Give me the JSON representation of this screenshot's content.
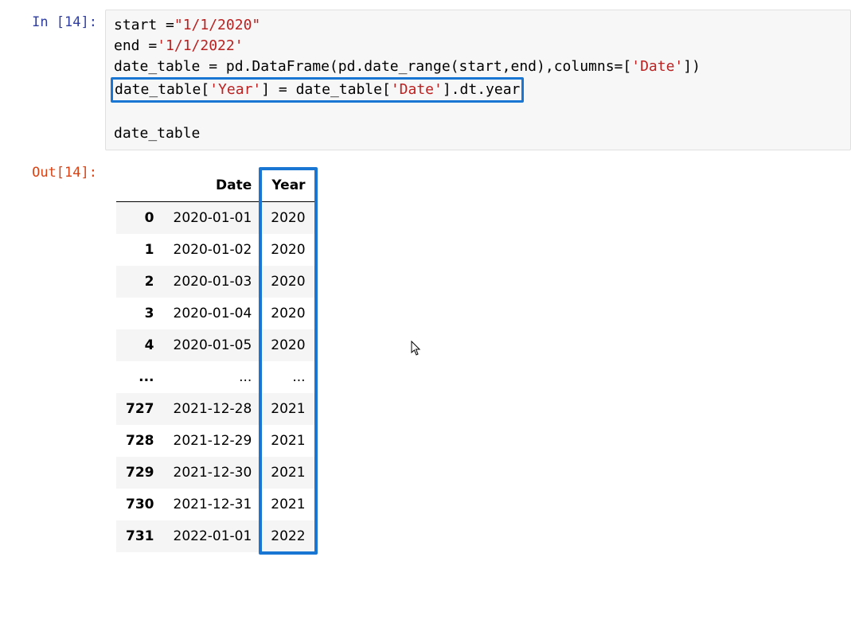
{
  "input": {
    "prompt_prefix": "In [",
    "exec_count": "14",
    "prompt_suffix": "]:",
    "code_tokens": [
      [
        {
          "t": "start ",
          "c": "plain"
        },
        {
          "t": "=",
          "c": "plain"
        },
        {
          "t": "\"1/1/2020\"",
          "c": "str"
        }
      ],
      [
        {
          "t": "end ",
          "c": "plain"
        },
        {
          "t": "=",
          "c": "plain"
        },
        {
          "t": "'1/1/2022'",
          "c": "str"
        }
      ],
      [
        {
          "t": "date_table ",
          "c": "plain"
        },
        {
          "t": "= pd.DataFrame(pd.date_range(start,end),columns=[",
          "c": "plain"
        },
        {
          "t": "'Date'",
          "c": "str"
        },
        {
          "t": "])",
          "c": "plain"
        }
      ],
      [
        {
          "t": "date_table[",
          "c": "plain",
          "hl": true
        },
        {
          "t": "'Year'",
          "c": "str",
          "hl": true
        },
        {
          "t": "] = date_table[",
          "c": "plain",
          "hl": true
        },
        {
          "t": "'Date'",
          "c": "str",
          "hl": true
        },
        {
          "t": "].dt.year",
          "c": "plain",
          "hl": true
        }
      ],
      [
        {
          "t": "",
          "c": "plain"
        }
      ],
      [
        {
          "t": "date_table",
          "c": "plain"
        }
      ]
    ]
  },
  "output": {
    "prompt_prefix": "Out[",
    "exec_count": "14",
    "prompt_suffix": "]:",
    "columns": [
      "Date",
      "Year"
    ],
    "rows": [
      {
        "idx": "0",
        "date": "2020-01-01",
        "year": "2020"
      },
      {
        "idx": "1",
        "date": "2020-01-02",
        "year": "2020"
      },
      {
        "idx": "2",
        "date": "2020-01-03",
        "year": "2020"
      },
      {
        "idx": "3",
        "date": "2020-01-04",
        "year": "2020"
      },
      {
        "idx": "4",
        "date": "2020-01-05",
        "year": "2020"
      },
      {
        "idx": "...",
        "date": "...",
        "year": "..."
      },
      {
        "idx": "727",
        "date": "2021-12-28",
        "year": "2021"
      },
      {
        "idx": "728",
        "date": "2021-12-29",
        "year": "2021"
      },
      {
        "idx": "729",
        "date": "2021-12-30",
        "year": "2021"
      },
      {
        "idx": "730",
        "date": "2021-12-31",
        "year": "2021"
      },
      {
        "idx": "731",
        "date": "2022-01-01",
        "year": "2022"
      }
    ]
  },
  "cursor_glyph": "↖"
}
